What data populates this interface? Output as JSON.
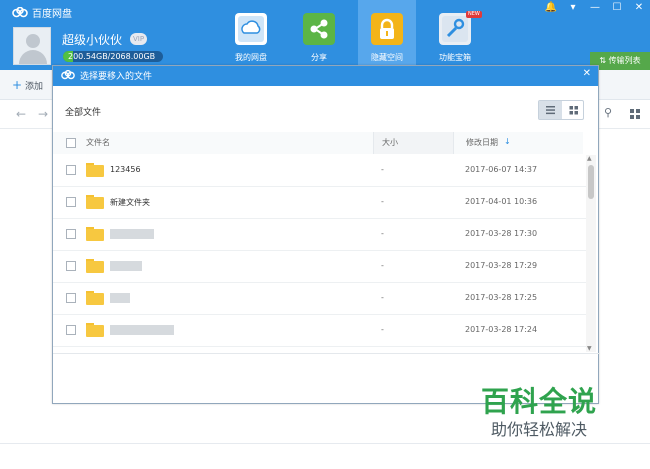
{
  "app": {
    "title": "百度网盘"
  },
  "user": {
    "name": "超级小伙伙",
    "vip": "VIP",
    "quota_text": "200.54GB/2068.00GB",
    "quota_used_fraction": 0.097
  },
  "nav": [
    {
      "label": "我的网盘",
      "icon": "cloud-icon"
    },
    {
      "label": "分享",
      "icon": "share-icon"
    },
    {
      "label": "隐藏空间",
      "icon": "lock-icon"
    },
    {
      "label": "功能宝箱",
      "icon": "toolbox-icon",
      "badge": "NEW"
    }
  ],
  "transfer_label": "传输列表",
  "toolbar": {
    "add_label": "添加"
  },
  "dialog": {
    "title": "选择要移入的文件",
    "path": "全部文件",
    "columns": {
      "name": "文件名",
      "size": "大小",
      "date": "修改日期"
    },
    "rows": [
      {
        "name": "123456",
        "size": "-",
        "date": "2017-06-07 14:37"
      },
      {
        "name": "新建文件夹",
        "size": "-",
        "date": "2017-04-01 10:36"
      },
      {
        "name": "",
        "size": "-",
        "date": "2017-03-28 17:30"
      },
      {
        "name": "",
        "size": "-",
        "date": "2017-03-28 17:29"
      },
      {
        "name": "",
        "size": "-",
        "date": "2017-03-28 17:25"
      },
      {
        "name": "",
        "size": "-",
        "date": "2017-03-28 17:24"
      }
    ]
  },
  "watermark": {
    "main": "百科全说",
    "sub": "助你轻松解决"
  },
  "colors": {
    "primary": "#2f8fe0",
    "accent_green": "#55a84a",
    "folder": "#f7c840"
  }
}
